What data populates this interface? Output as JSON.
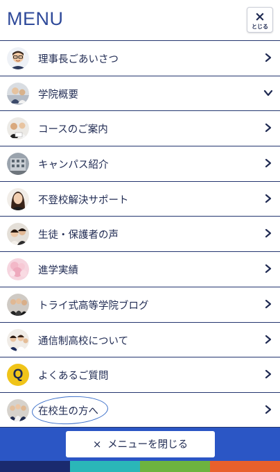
{
  "header": {
    "title": "MENU",
    "close_icon": "×",
    "close_label": "とじる"
  },
  "menu": [
    {
      "label": "理事長ごあいさつ",
      "icon": "chevron-right-icon"
    },
    {
      "label": "学院概要",
      "icon": "chevron-down-icon"
    },
    {
      "label": "コースのご案内",
      "icon": "chevron-right-icon"
    },
    {
      "label": "キャンパス紹介",
      "icon": "chevron-right-icon"
    },
    {
      "label": "不登校解決サポート",
      "icon": "chevron-right-icon"
    },
    {
      "label": "生徒・保護者の声",
      "icon": "chevron-right-icon"
    },
    {
      "label": "進学実績",
      "icon": "chevron-right-icon"
    },
    {
      "label": "トライ式高等学院ブログ",
      "icon": "chevron-right-icon"
    },
    {
      "label": "通信制高校について",
      "icon": "chevron-right-icon"
    },
    {
      "label": "よくあるご質問",
      "icon": "chevron-right-icon",
      "badge": "Q"
    },
    {
      "label": "在校生の方へ",
      "icon": "chevron-right-icon"
    }
  ],
  "footer": {
    "close_icon": "×",
    "close_label": "メニューを閉じる"
  },
  "colors": {
    "accent": "#2b56c5",
    "text": "#1f2a52",
    "q_badge": "#f0c419",
    "bottom_bars": [
      "#1a2a6e",
      "#2ab7b8",
      "#6db33f",
      "#e8602c"
    ]
  }
}
